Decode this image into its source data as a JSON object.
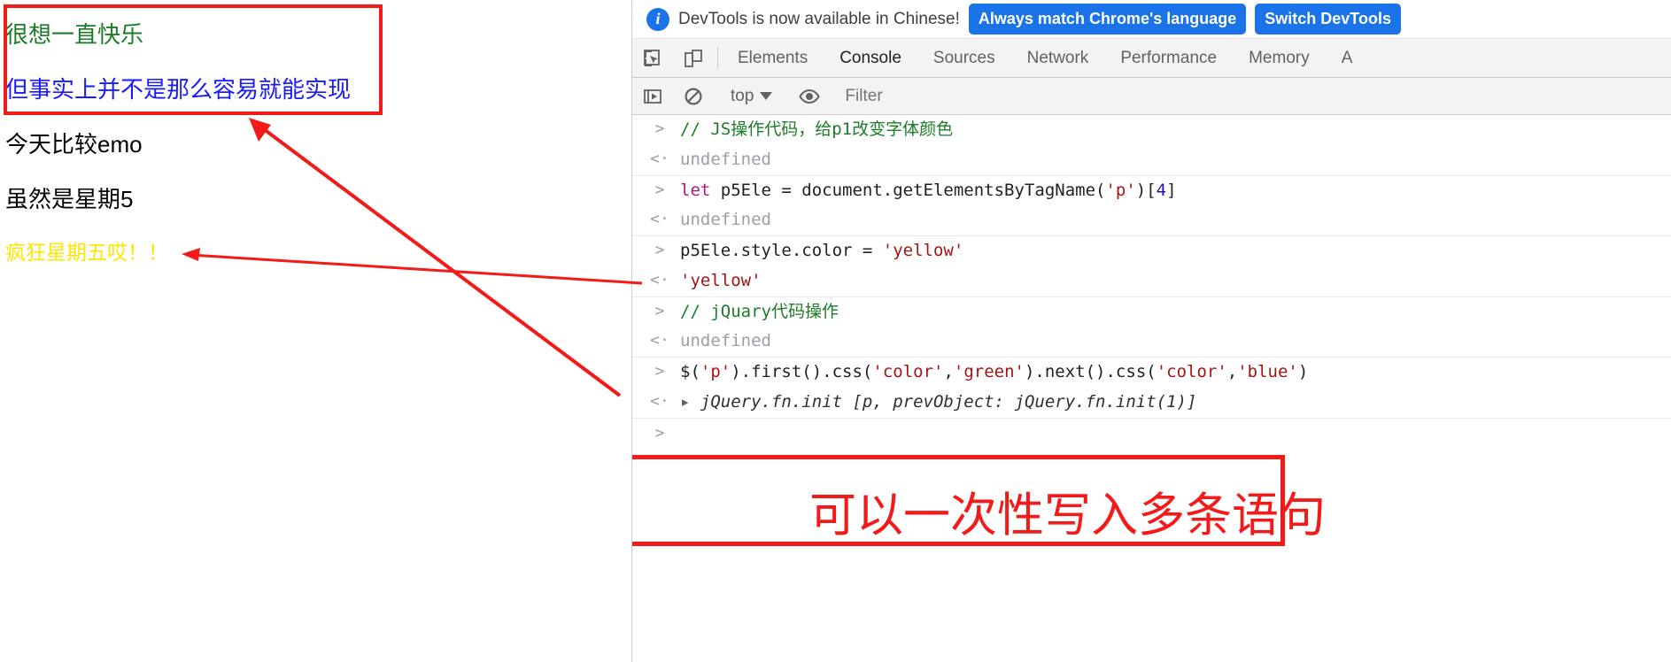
{
  "webpage": {
    "paragraphs": [
      {
        "text": "很想一直快乐",
        "color": "#1c7c28"
      },
      {
        "text": "但事实上并不是那么容易就能实现",
        "color": "#1a1aff"
      },
      {
        "text": "今天比较emo",
        "color": "#000000"
      },
      {
        "text": "虽然是星期5",
        "color": "#000000"
      },
      {
        "text": "疯狂星期五哎！！",
        "color": "#ffe600"
      }
    ]
  },
  "annotations": {
    "box_color": "#f31a1a",
    "caption": "可以一次性写入多条语句"
  },
  "devtools": {
    "banner": {
      "icon": "info-icon",
      "message": "DevTools is now available in Chinese!",
      "primary_button": "Always match Chrome's language",
      "secondary_button": "Switch DevTools",
      "accent_color": "#1a73e8"
    },
    "tabs": [
      {
        "label": "Elements",
        "active": false
      },
      {
        "label": "Console",
        "active": true
      },
      {
        "label": "Sources",
        "active": false
      },
      {
        "label": "Network",
        "active": false
      },
      {
        "label": "Performance",
        "active": false
      },
      {
        "label": "Memory",
        "active": false
      },
      {
        "label": "A",
        "active": false
      }
    ],
    "toolbar": {
      "execute_icon": "execute-sidebar-icon",
      "clear_icon": "clear-console-icon",
      "context": "top",
      "eye_icon": "live-expression-eye-icon",
      "filter_placeholder": "Filter",
      "filter_value": ""
    },
    "console": [
      {
        "kind": "command",
        "gutter": ">",
        "segments": [
          {
            "t": "// JS操作代码，给p1改变字体颜色",
            "c": "comment"
          }
        ]
      },
      {
        "kind": "result",
        "gutter": "<·",
        "segments": [
          {
            "t": "undefined",
            "c": "undef"
          }
        ]
      },
      {
        "kind": "command",
        "gutter": ">",
        "segments": [
          {
            "t": "let",
            "c": "kw"
          },
          {
            "t": " p5Ele = document.getElementsByTagName(",
            "c": "code"
          },
          {
            "t": "'p'",
            "c": "str"
          },
          {
            "t": ")[",
            "c": "code"
          },
          {
            "t": "4",
            "c": "num"
          },
          {
            "t": "]",
            "c": "code"
          }
        ]
      },
      {
        "kind": "result",
        "gutter": "<·",
        "segments": [
          {
            "t": "undefined",
            "c": "undef"
          }
        ]
      },
      {
        "kind": "command",
        "gutter": ">",
        "segments": [
          {
            "t": "p5Ele.style.color = ",
            "c": "code"
          },
          {
            "t": "'yellow'",
            "c": "str"
          }
        ]
      },
      {
        "kind": "result",
        "gutter": "<·",
        "segments": [
          {
            "t": "'yellow'",
            "c": "str"
          }
        ]
      },
      {
        "kind": "command",
        "gutter": ">",
        "segments": [
          {
            "t": "// jQuary代码操作",
            "c": "comment"
          }
        ]
      },
      {
        "kind": "result",
        "gutter": "<·",
        "segments": [
          {
            "t": "undefined",
            "c": "undef"
          }
        ]
      },
      {
        "kind": "command",
        "gutter": ">",
        "segments": [
          {
            "t": "$(",
            "c": "code"
          },
          {
            "t": "'p'",
            "c": "str"
          },
          {
            "t": ").first().css(",
            "c": "code"
          },
          {
            "t": "'color'",
            "c": "str"
          },
          {
            "t": ",",
            "c": "code"
          },
          {
            "t": "'green'",
            "c": "str"
          },
          {
            "t": ").next().css(",
            "c": "code"
          },
          {
            "t": "'color'",
            "c": "str"
          },
          {
            "t": ",",
            "c": "code"
          },
          {
            "t": "'blue'",
            "c": "str"
          },
          {
            "t": ")",
            "c": "code"
          }
        ]
      },
      {
        "kind": "result",
        "gutter": "<·",
        "segments": [
          {
            "t": "▸ ",
            "c": "tri"
          },
          {
            "t": "jQuery.fn.init [p, prevObject: jQuery.fn.init(1)]",
            "c": "jq-res"
          }
        ]
      }
    ],
    "prompt": {
      "gutter": ">",
      "value": ""
    }
  }
}
